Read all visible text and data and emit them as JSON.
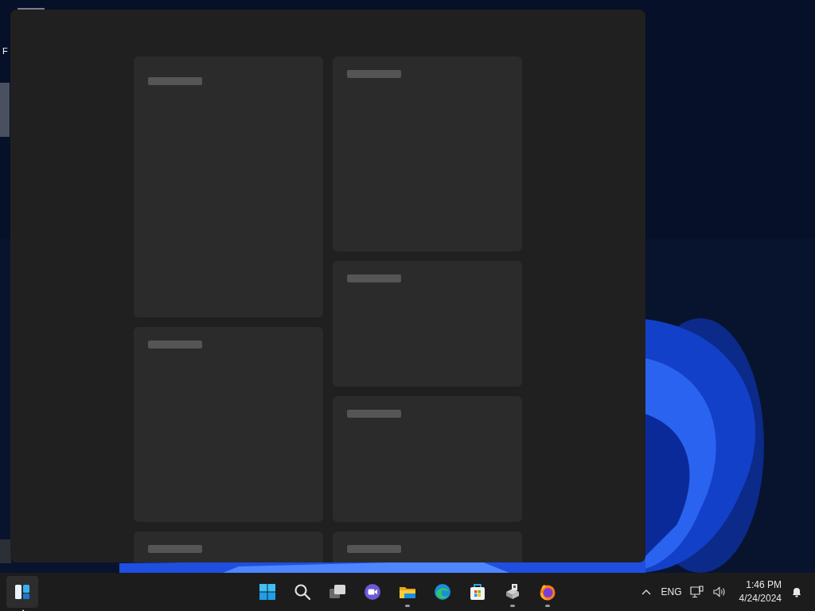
{
  "desktop": {
    "icon_label": "F"
  },
  "widgets_panel": {
    "loading": true
  },
  "taskbar": {
    "widgets_button": {
      "selected": true
    },
    "apps": [
      {
        "kind": "start",
        "running": false
      },
      {
        "kind": "search",
        "running": false
      },
      {
        "kind": "taskview",
        "running": false
      },
      {
        "kind": "chat",
        "running": false
      },
      {
        "kind": "explorer",
        "running": true
      },
      {
        "kind": "edge",
        "running": false
      },
      {
        "kind": "store",
        "running": false
      },
      {
        "kind": "drive",
        "running": true
      },
      {
        "kind": "firefox",
        "running": true
      }
    ],
    "tray": {
      "language": "ENG",
      "time": "1:46 PM",
      "date": "4/24/2024"
    }
  }
}
